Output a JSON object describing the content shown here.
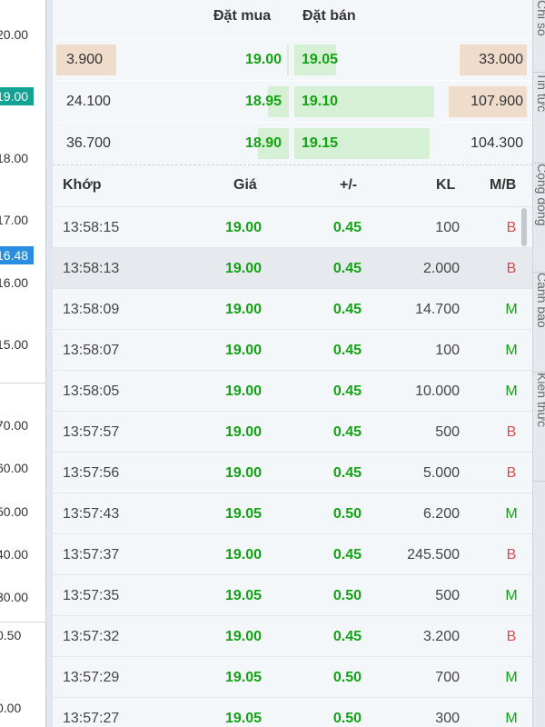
{
  "axis": {
    "labels": [
      "20.00",
      "18.00",
      "17.00",
      "16.00",
      "15.00",
      "70.00",
      "60.00",
      "50.00",
      "40.00",
      "30.00",
      "0.50",
      "0.00"
    ],
    "current_price_badge": "19.00",
    "hover_badge": "16.48",
    "colors": {
      "current": "#13a394",
      "hover": "#2a8ee0"
    }
  },
  "orderbook": {
    "headers": {
      "bid": "Đặt mua",
      "ask": "Đặt bán"
    },
    "rows": [
      {
        "bid_volume": "3.900",
        "bid_price": "19.00",
        "ask_price": "19.05",
        "ask_volume": "33.000",
        "bid_bar": 0.02,
        "ask_bar": 0.3
      },
      {
        "bid_volume": "24.100",
        "bid_price": "18.95",
        "ask_price": "19.10",
        "ask_volume": "107.900",
        "bid_bar": 0.3,
        "ask_bar": 1.0
      },
      {
        "bid_volume": "36.700",
        "bid_price": "18.90",
        "ask_price": "19.15",
        "ask_volume": "104.300",
        "bid_bar": 0.45,
        "ask_bar": 0.97
      }
    ]
  },
  "trades": {
    "headers": {
      "time": "Khớp",
      "price": "Giá",
      "change": "+/-",
      "volume": "KL",
      "side": "M/B"
    },
    "rows": [
      {
        "time": "13:58:15",
        "price": "19.00",
        "change": "0.45",
        "volume": "100",
        "side": "B"
      },
      {
        "time": "13:58:13",
        "price": "19.00",
        "change": "0.45",
        "volume": "2.000",
        "side": "B"
      },
      {
        "time": "13:58:09",
        "price": "19.00",
        "change": "0.45",
        "volume": "14.700",
        "side": "M"
      },
      {
        "time": "13:58:07",
        "price": "19.00",
        "change": "0.45",
        "volume": "100",
        "side": "M"
      },
      {
        "time": "13:58:05",
        "price": "19.00",
        "change": "0.45",
        "volume": "10.000",
        "side": "M"
      },
      {
        "time": "13:57:57",
        "price": "19.00",
        "change": "0.45",
        "volume": "500",
        "side": "B"
      },
      {
        "time": "13:57:56",
        "price": "19.00",
        "change": "0.45",
        "volume": "5.000",
        "side": "B"
      },
      {
        "time": "13:57:43",
        "price": "19.05",
        "change": "0.50",
        "volume": "6.200",
        "side": "M"
      },
      {
        "time": "13:57:37",
        "price": "19.00",
        "change": "0.45",
        "volume": "245.500",
        "side": "B"
      },
      {
        "time": "13:57:35",
        "price": "19.05",
        "change": "0.50",
        "volume": "500",
        "side": "M"
      },
      {
        "time": "13:57:32",
        "price": "19.00",
        "change": "0.45",
        "volume": "3.200",
        "side": "B"
      },
      {
        "time": "13:57:29",
        "price": "19.05",
        "change": "0.50",
        "volume": "700",
        "side": "M"
      },
      {
        "time": "13:57:27",
        "price": "19.05",
        "change": "0.50",
        "volume": "300",
        "side": "M"
      }
    ]
  },
  "side_tabs": [
    "Chỉ số",
    "Tin tức",
    "Cộng đồng",
    "Cảnh báo",
    "Kiến thức"
  ],
  "colors": {
    "up": "#12a312",
    "buy_bar": "#d6f0d6",
    "sell_vol_bg": "#f0dccb",
    "sell_side": "#e04a4a"
  }
}
